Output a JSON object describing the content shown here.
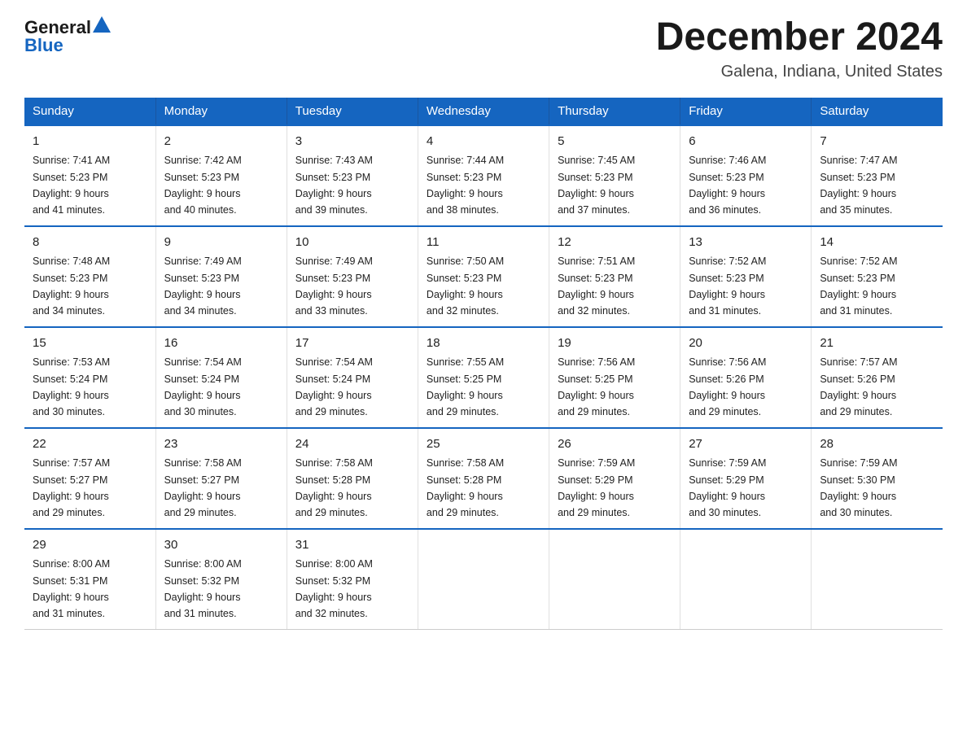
{
  "logo": {
    "general": "General",
    "triangle_symbol": "▶",
    "blue": "Blue"
  },
  "header": {
    "month": "December 2024",
    "location": "Galena, Indiana, United States"
  },
  "weekdays": [
    "Sunday",
    "Monday",
    "Tuesday",
    "Wednesday",
    "Thursday",
    "Friday",
    "Saturday"
  ],
  "weeks": [
    [
      {
        "day": "1",
        "sunrise": "7:41 AM",
        "sunset": "5:23 PM",
        "daylight": "9 hours and 41 minutes."
      },
      {
        "day": "2",
        "sunrise": "7:42 AM",
        "sunset": "5:23 PM",
        "daylight": "9 hours and 40 minutes."
      },
      {
        "day": "3",
        "sunrise": "7:43 AM",
        "sunset": "5:23 PM",
        "daylight": "9 hours and 39 minutes."
      },
      {
        "day": "4",
        "sunrise": "7:44 AM",
        "sunset": "5:23 PM",
        "daylight": "9 hours and 38 minutes."
      },
      {
        "day": "5",
        "sunrise": "7:45 AM",
        "sunset": "5:23 PM",
        "daylight": "9 hours and 37 minutes."
      },
      {
        "day": "6",
        "sunrise": "7:46 AM",
        "sunset": "5:23 PM",
        "daylight": "9 hours and 36 minutes."
      },
      {
        "day": "7",
        "sunrise": "7:47 AM",
        "sunset": "5:23 PM",
        "daylight": "9 hours and 35 minutes."
      }
    ],
    [
      {
        "day": "8",
        "sunrise": "7:48 AM",
        "sunset": "5:23 PM",
        "daylight": "9 hours and 34 minutes."
      },
      {
        "day": "9",
        "sunrise": "7:49 AM",
        "sunset": "5:23 PM",
        "daylight": "9 hours and 34 minutes."
      },
      {
        "day": "10",
        "sunrise": "7:49 AM",
        "sunset": "5:23 PM",
        "daylight": "9 hours and 33 minutes."
      },
      {
        "day": "11",
        "sunrise": "7:50 AM",
        "sunset": "5:23 PM",
        "daylight": "9 hours and 32 minutes."
      },
      {
        "day": "12",
        "sunrise": "7:51 AM",
        "sunset": "5:23 PM",
        "daylight": "9 hours and 32 minutes."
      },
      {
        "day": "13",
        "sunrise": "7:52 AM",
        "sunset": "5:23 PM",
        "daylight": "9 hours and 31 minutes."
      },
      {
        "day": "14",
        "sunrise": "7:52 AM",
        "sunset": "5:23 PM",
        "daylight": "9 hours and 31 minutes."
      }
    ],
    [
      {
        "day": "15",
        "sunrise": "7:53 AM",
        "sunset": "5:24 PM",
        "daylight": "9 hours and 30 minutes."
      },
      {
        "day": "16",
        "sunrise": "7:54 AM",
        "sunset": "5:24 PM",
        "daylight": "9 hours and 30 minutes."
      },
      {
        "day": "17",
        "sunrise": "7:54 AM",
        "sunset": "5:24 PM",
        "daylight": "9 hours and 29 minutes."
      },
      {
        "day": "18",
        "sunrise": "7:55 AM",
        "sunset": "5:25 PM",
        "daylight": "9 hours and 29 minutes."
      },
      {
        "day": "19",
        "sunrise": "7:56 AM",
        "sunset": "5:25 PM",
        "daylight": "9 hours and 29 minutes."
      },
      {
        "day": "20",
        "sunrise": "7:56 AM",
        "sunset": "5:26 PM",
        "daylight": "9 hours and 29 minutes."
      },
      {
        "day": "21",
        "sunrise": "7:57 AM",
        "sunset": "5:26 PM",
        "daylight": "9 hours and 29 minutes."
      }
    ],
    [
      {
        "day": "22",
        "sunrise": "7:57 AM",
        "sunset": "5:27 PM",
        "daylight": "9 hours and 29 minutes."
      },
      {
        "day": "23",
        "sunrise": "7:58 AM",
        "sunset": "5:27 PM",
        "daylight": "9 hours and 29 minutes."
      },
      {
        "day": "24",
        "sunrise": "7:58 AM",
        "sunset": "5:28 PM",
        "daylight": "9 hours and 29 minutes."
      },
      {
        "day": "25",
        "sunrise": "7:58 AM",
        "sunset": "5:28 PM",
        "daylight": "9 hours and 29 minutes."
      },
      {
        "day": "26",
        "sunrise": "7:59 AM",
        "sunset": "5:29 PM",
        "daylight": "9 hours and 29 minutes."
      },
      {
        "day": "27",
        "sunrise": "7:59 AM",
        "sunset": "5:29 PM",
        "daylight": "9 hours and 30 minutes."
      },
      {
        "day": "28",
        "sunrise": "7:59 AM",
        "sunset": "5:30 PM",
        "daylight": "9 hours and 30 minutes."
      }
    ],
    [
      {
        "day": "29",
        "sunrise": "8:00 AM",
        "sunset": "5:31 PM",
        "daylight": "9 hours and 31 minutes."
      },
      {
        "day": "30",
        "sunrise": "8:00 AM",
        "sunset": "5:32 PM",
        "daylight": "9 hours and 31 minutes."
      },
      {
        "day": "31",
        "sunrise": "8:00 AM",
        "sunset": "5:32 PM",
        "daylight": "9 hours and 32 minutes."
      },
      null,
      null,
      null,
      null
    ]
  ],
  "labels": {
    "sunrise": "Sunrise:",
    "sunset": "Sunset:",
    "daylight": "Daylight:"
  },
  "colors": {
    "header_bg": "#1565C0",
    "border_top": "#1565C0",
    "logo_blue": "#1565C0"
  }
}
